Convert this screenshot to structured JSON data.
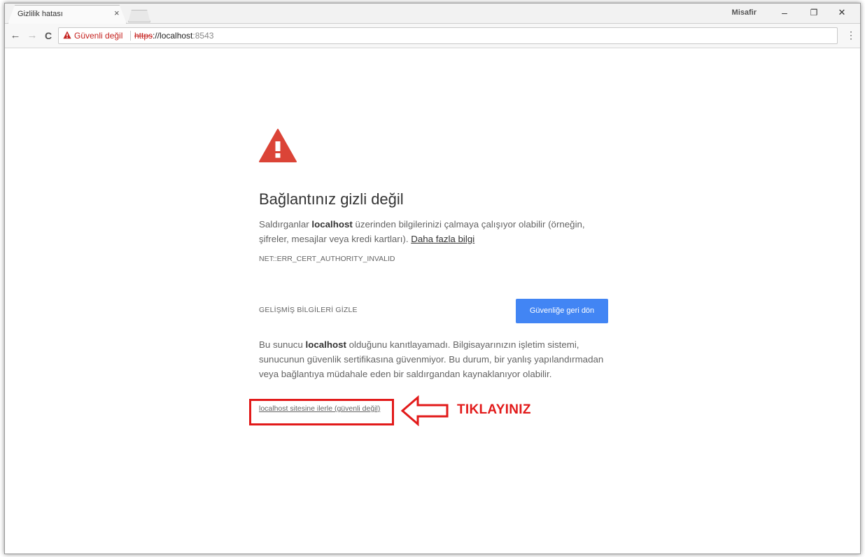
{
  "tab": {
    "title": "Gizlilik hatası",
    "close_glyph": "×"
  },
  "window": {
    "profile_name": "Misafir",
    "minimize_glyph": "–",
    "restore_glyph": "❐",
    "close_glyph": "✕"
  },
  "toolbar": {
    "back_glyph": "←",
    "forward_glyph": "→",
    "reload_glyph": "C",
    "insecure_label": "Güvenli değil",
    "url_scheme": "https",
    "url_sep": "://",
    "url_host": "localhost",
    "url_port": ":8543",
    "menu_glyph": "⋮"
  },
  "page": {
    "heading": "Bağlantınız gizli değil",
    "intro_before": "Saldırganlar ",
    "intro_host": "localhost",
    "intro_after": " üzerinden bilgilerinizi çalmaya çalışıyor olabilir (örneğin, şifreler, mesajlar veya kredi kartları). ",
    "learn_more": "Daha fazla bilgi",
    "error_code": "NET::ERR_CERT_AUTHORITY_INVALID",
    "advanced_toggle": "GELİŞMİŞ BİLGİLERİ GİZLE",
    "back_button": "Güvenliğe geri dön",
    "details_before": "Bu sunucu ",
    "details_host": "localhost",
    "details_after": " olduğunu kanıtlayamadı. Bilgisayarınızın işletim sistemi, sunucunun güvenlik sertifikasına güvenmiyor. Bu durum, bir yanlış yapılandırmadan veya bağlantıya müdahale eden bir saldırgandan kaynaklanıyor olabilir.",
    "proceed_link": "localhost sitesine ilerle (güvenli değil)"
  },
  "annotation": {
    "label": "TIKLAYINIZ",
    "color": "#e21a1a"
  },
  "colors": {
    "warning_red": "#db4437",
    "button_blue": "#4285f4",
    "insecure_red": "#c5221f"
  },
  "icons": {
    "page_warning": "warning-triangle-icon",
    "omnibox_warning": "warning-triangle-icon",
    "annotation_arrow": "left-arrow-icon"
  }
}
